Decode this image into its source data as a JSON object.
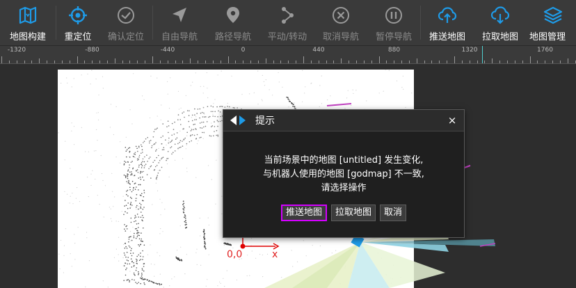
{
  "toolbar": {
    "items": [
      {
        "label": "地图构建",
        "icon": "map-icon",
        "enabled": true
      },
      {
        "label": "重定位",
        "icon": "crosshair-icon",
        "enabled": true
      },
      {
        "label": "确认定位",
        "icon": "check-circle-icon",
        "enabled": false
      },
      {
        "label": "自由导航",
        "icon": "navigation-arrow-icon",
        "enabled": false
      },
      {
        "label": "路径导航",
        "icon": "location-pin-icon",
        "enabled": false
      },
      {
        "label": "平动/转动",
        "icon": "path-nodes-icon",
        "enabled": false
      },
      {
        "label": "取消导航",
        "icon": "cancel-circle-icon",
        "enabled": false
      },
      {
        "label": "暂停导航",
        "icon": "pause-circle-icon",
        "enabled": false
      },
      {
        "label": "推送地图",
        "icon": "cloud-upload-icon",
        "enabled": true
      },
      {
        "label": "拉取地图",
        "icon": "cloud-download-icon",
        "enabled": true
      },
      {
        "label": "地图管理",
        "icon": "layers-icon",
        "enabled": true
      }
    ],
    "accent_color": "#1e9be8",
    "disabled_color": "#8a8a8a"
  },
  "ruler": {
    "labels": [
      "-1320",
      "-880",
      "-440",
      "0",
      "440",
      "880",
      "1320",
      "1760"
    ]
  },
  "canvas": {
    "origin_label": "0,0",
    "x_axis_label": "x",
    "axis_color": "#e00000"
  },
  "dialog": {
    "title": "提示",
    "close_glyph": "×",
    "message_lines": [
      "当前场景中的地图 [untitled] 发生变化,",
      "与机器人使用的地图 [godmap] 不一致,",
      "请选择操作"
    ],
    "buttons": {
      "push": "推送地图",
      "pull": "拉取地图",
      "cancel": "取消"
    }
  }
}
